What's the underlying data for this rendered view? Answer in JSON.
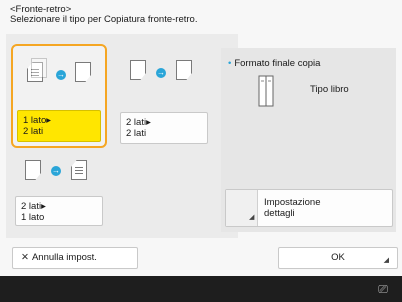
{
  "header": {
    "title": "<Fronte-retro>",
    "instruction": "Selezionare il tipo per Copiatura fronte-retro."
  },
  "options": [
    {
      "label_line1": "1 lato▸",
      "label_line2": "2 lati",
      "selected": true
    },
    {
      "label_line1": "2 lati▸",
      "label_line2": "2 lati",
      "selected": false
    },
    {
      "label_line1": "2 lati▸",
      "label_line2": "1 lato",
      "selected": false
    }
  ],
  "final_format": {
    "title": "Formato finale copia",
    "value": "Tipo libro"
  },
  "details_button": {
    "line1": "Impostazione",
    "line2": "dettagli"
  },
  "footer": {
    "cancel_label": "Annulla impost.",
    "ok_label": "OK"
  },
  "colors": {
    "selected_fill": "#ffe600",
    "selected_border": "#f5a623",
    "arrow": "#2aa5d8"
  },
  "icons": {
    "cancel": "close-icon",
    "status": "status-monitor-icon"
  }
}
